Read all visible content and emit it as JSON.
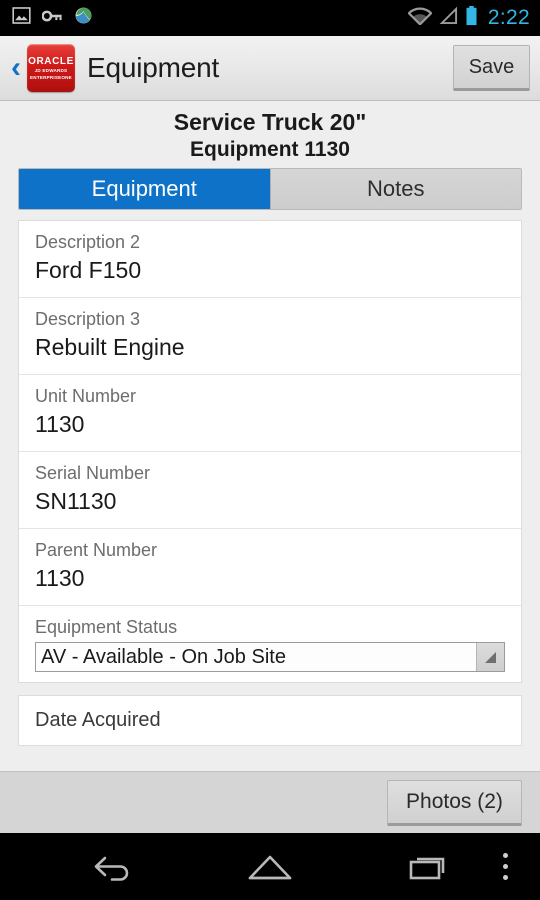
{
  "statusbar": {
    "icons": [
      "image-icon",
      "key-icon",
      "browser-icon",
      "wifi-icon",
      "signal-icon",
      "battery-icon"
    ],
    "time": "2:22",
    "time_color": "#33b5e5"
  },
  "appbar": {
    "back_label": "‹",
    "logo": {
      "brand": "ORACLE",
      "product_line1": "JD EDWARDS",
      "product_line2": "ENTERPRISEONE",
      "color": "#cf1a18"
    },
    "title": "Equipment",
    "save_label": "Save"
  },
  "header": {
    "title": "Service Truck 20\"",
    "subtitle": "Equipment 1130"
  },
  "tabs": {
    "active_color": "#0d72c8",
    "items": [
      {
        "label": "Equipment",
        "active": true
      },
      {
        "label": "Notes",
        "active": false
      }
    ]
  },
  "form": {
    "fields": [
      {
        "label": "Description 2",
        "value": "Ford F150"
      },
      {
        "label": "Description 3",
        "value": "Rebuilt Engine"
      },
      {
        "label": "Unit Number",
        "value": "1130"
      },
      {
        "label": "Serial Number",
        "value": "SN1130"
      },
      {
        "label": "Parent Number",
        "value": "1130"
      }
    ],
    "status_field": {
      "label": "Equipment Status",
      "value": "AV - Available - On Job Site"
    },
    "date_field": {
      "label": "Date Acquired"
    }
  },
  "bottombar": {
    "photos_label": "Photos (2)"
  },
  "navbar": {
    "back": "back-icon",
    "home": "home-icon",
    "recents": "recents-icon",
    "menu": "overflow-menu-icon"
  }
}
